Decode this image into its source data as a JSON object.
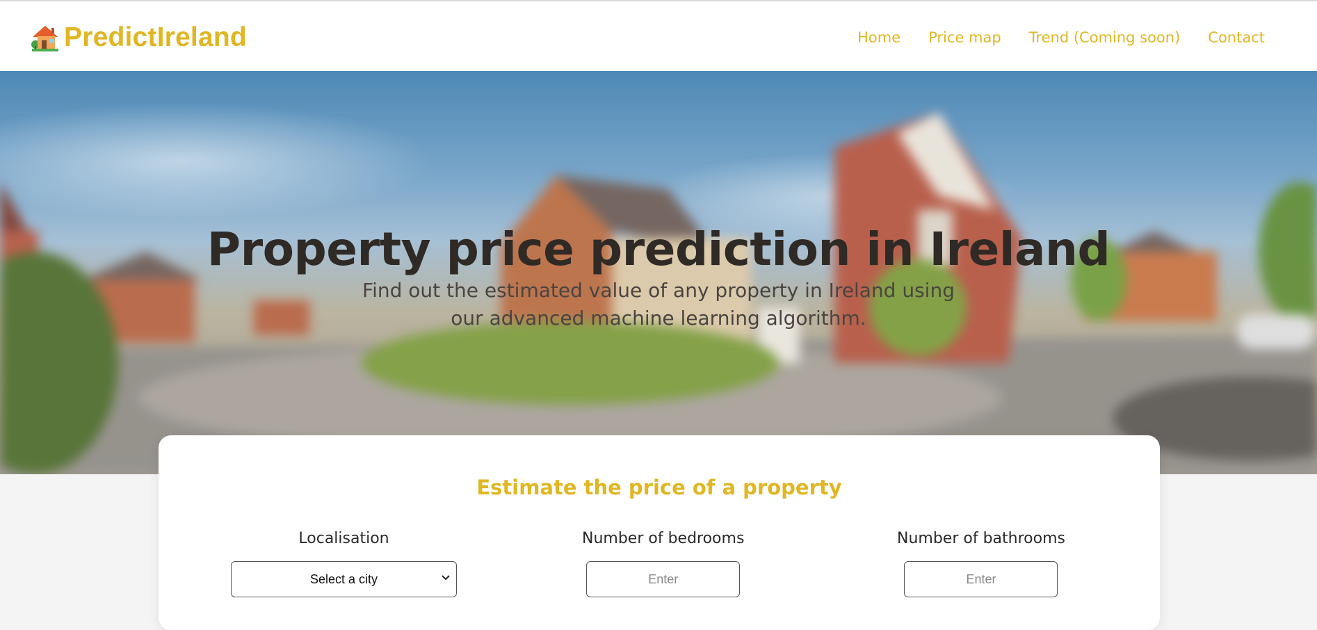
{
  "brand": {
    "name": "PredictIreland",
    "logo_icon": "house-icon",
    "color": "#e0b623"
  },
  "nav": {
    "items": [
      {
        "label": "Home"
      },
      {
        "label": "Price map"
      },
      {
        "label": "Trend (Coming soon)"
      },
      {
        "label": "Contact"
      }
    ]
  },
  "hero": {
    "title": "Property price prediction in Ireland",
    "subtitle": "Find out the estimated value of any property in Ireland using our advanced machine learning algorithm."
  },
  "estimator": {
    "title": "Estimate the price of a property",
    "localisation": {
      "label": "Localisation",
      "selected": "Select a city"
    },
    "bedrooms": {
      "label": "Number of bedrooms",
      "placeholder": "Enter"
    },
    "bathrooms": {
      "label": "Number of bathrooms",
      "placeholder": "Enter"
    }
  }
}
